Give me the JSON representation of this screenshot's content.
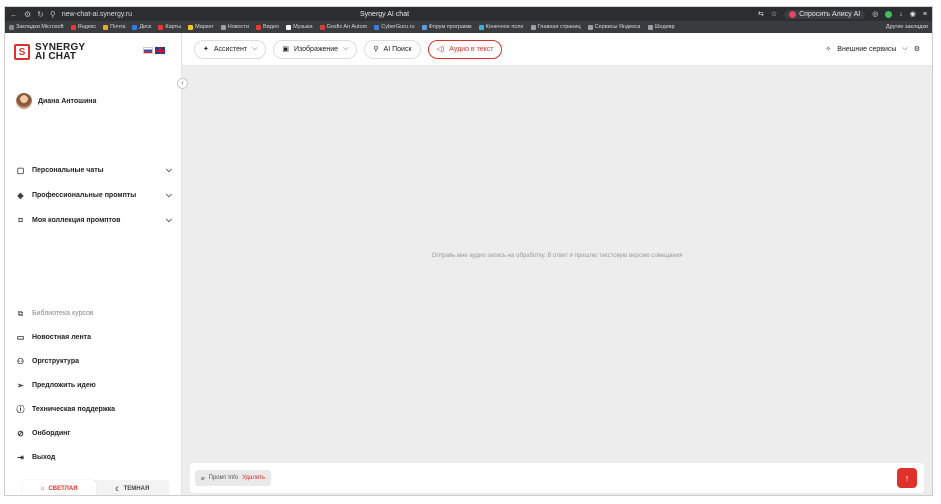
{
  "browser": {
    "url": "new-chat-ai.synergy.ru",
    "window_title": "Synergy AI chat",
    "alice_label": "Спросить Алису AI",
    "bookmarks": [
      {
        "label": "Закладки Microsoft",
        "color": "#888888"
      },
      {
        "label": "Яндекс",
        "color": "#e83a2f"
      },
      {
        "label": "Почта",
        "color": "#f5a623"
      },
      {
        "label": "Диск",
        "color": "#2f7ee8"
      },
      {
        "label": "Карты",
        "color": "#e83a2f"
      },
      {
        "label": "Маркет",
        "color": "#f5c623"
      },
      {
        "label": "Новости",
        "color": "#9aa0a6"
      },
      {
        "label": "Видео",
        "color": "#e83a2f"
      },
      {
        "label": "Музыка",
        "color": "#ffffff"
      },
      {
        "label": "Gosfix An Autom",
        "color": "#d83b3b"
      },
      {
        "label": "CyberGuru.ru",
        "color": "#3b7fd8"
      },
      {
        "label": "Форум программ",
        "color": "#5aa0e0"
      },
      {
        "label": "Конечное поле",
        "color": "#3bb0d8"
      },
      {
        "label": "Главная страниц",
        "color": "#9aa0a6"
      },
      {
        "label": "Сервисы Яндекса",
        "color": "#9aa0a6"
      },
      {
        "label": "Шедевр",
        "color": "#9aa0a6"
      }
    ],
    "other_bookmarks": "Другие закладки"
  },
  "sidebar": {
    "logo_line1": "SYNERGY",
    "logo_line2": "AI CHAT",
    "collapse_icon": "‹",
    "user_name": "Диана Антошина",
    "sections": [
      {
        "label": "Персональные чаты",
        "icon": "chat-icon"
      },
      {
        "label": "Профессиональные промпты",
        "icon": "layers-icon"
      },
      {
        "label": "Моя коллекция промптов",
        "icon": "bookmark-icon"
      }
    ],
    "links": [
      {
        "label": "Библиотека курсов",
        "icon": "books-icon",
        "muted": true
      },
      {
        "label": "Новостная лента",
        "icon": "news-icon"
      },
      {
        "label": "Оргструктура",
        "icon": "people-icon"
      },
      {
        "label": "Предложить идею",
        "icon": "send-icon"
      },
      {
        "label": "Техническая поддержка",
        "icon": "help-icon"
      },
      {
        "label": "Онбординг",
        "icon": "compass-icon"
      },
      {
        "label": "Выход",
        "icon": "logout-icon"
      }
    ],
    "theme": {
      "light": "СВЕТЛАЯ",
      "dark": "ТЕМНАЯ"
    }
  },
  "toolbar": {
    "assistant": "Ассистент",
    "image": "Изображение",
    "ai_search": "AI Поиск",
    "audio_to_text": "Аудио в текст",
    "external_services": "Внешние сервисы"
  },
  "main": {
    "hint": "Отправь мне аудио запись на обработку. В ответ я пришлю текстовую версию совещания",
    "chip_label": "Промт Info",
    "chip_delete": "Удалить"
  },
  "colors": {
    "accent": "#e0312b",
    "main_bg": "#ededed"
  }
}
